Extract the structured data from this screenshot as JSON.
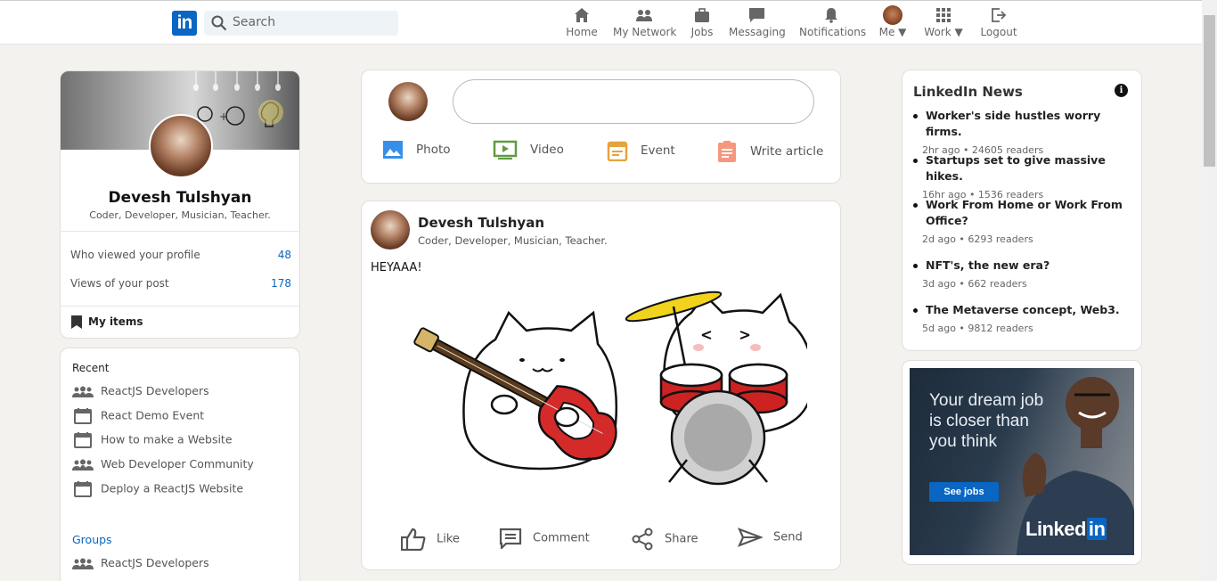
{
  "header": {
    "logo_text": "in",
    "search_placeholder": "Search",
    "nav": [
      {
        "label": "Home",
        "icon": "home-icon"
      },
      {
        "label": "My Network",
        "icon": "network-icon"
      },
      {
        "label": "Jobs",
        "icon": "briefcase-icon"
      },
      {
        "label": "Messaging",
        "icon": "messaging-icon"
      },
      {
        "label": "Notifications",
        "icon": "bell-icon"
      },
      {
        "label": "Me ▼",
        "icon": "avatar"
      },
      {
        "label": "Work ▼",
        "icon": "grid-icon"
      },
      {
        "label": "Logout",
        "icon": "logout-icon"
      }
    ]
  },
  "profile": {
    "name": "Devesh Tulshyan",
    "title": "Coder, Developer, Musician, Teacher.",
    "stats": [
      {
        "label": "Who viewed your profile",
        "value": "48"
      },
      {
        "label": "Views of your post",
        "value": "178"
      }
    ],
    "my_items": "My items"
  },
  "recent": {
    "title": "Recent",
    "items": [
      {
        "label": "ReactJS Developers",
        "icon": "group-icon"
      },
      {
        "label": "React Demo Event",
        "icon": "calendar-icon"
      },
      {
        "label": "How to make a Website",
        "icon": "calendar-icon"
      },
      {
        "label": "Web Developer Community",
        "icon": "group-icon"
      },
      {
        "label": "Deploy a ReactJS Website",
        "icon": "calendar-icon"
      }
    ],
    "groups_title": "Groups",
    "groups": [
      {
        "label": "ReactJS Developers",
        "icon": "group-icon"
      }
    ]
  },
  "share": {
    "options": [
      {
        "label": "Photo",
        "icon": "photo-icon",
        "color": "#378fe9"
      },
      {
        "label": "Video",
        "icon": "video-icon",
        "color": "#5f9b41"
      },
      {
        "label": "Event",
        "icon": "event-icon",
        "color": "#e7a33e"
      },
      {
        "label": "Write article",
        "icon": "article-icon",
        "color": "#f5987e"
      }
    ]
  },
  "post": {
    "author": "Devesh Tulshyan",
    "subtitle": "Coder, Developer, Musician, Teacher.",
    "text": "HEYAAA!",
    "actions": [
      {
        "label": "Like",
        "icon": "like-icon"
      },
      {
        "label": "Comment",
        "icon": "comment-icon"
      },
      {
        "label": "Share",
        "icon": "share-icon"
      },
      {
        "label": "Send",
        "icon": "send-icon"
      }
    ]
  },
  "news": {
    "title": "LinkedIn News",
    "items": [
      {
        "headline": "Worker's side hustles worry firms.",
        "meta": "2hr ago  •  24605 readers"
      },
      {
        "headline": "Startups set to give massive hikes.",
        "meta": "16hr ago  •  1536 readers"
      },
      {
        "headline": "Work From Home or Work From Office?",
        "meta": "2d ago  •  6293 readers"
      },
      {
        "headline": "NFT's, the new era?",
        "meta": "3d ago  •  662 readers"
      },
      {
        "headline": "The Metaverse concept, Web3.",
        "meta": "5d ago  •  9812 readers"
      }
    ]
  },
  "ad": {
    "headline": "Your dream job is closer than you think",
    "button": "See jobs",
    "brand_pre": "Linked",
    "brand_in": "in"
  },
  "colors": {
    "accent": "#0a66c2",
    "page_bg": "#f3f2ef"
  }
}
